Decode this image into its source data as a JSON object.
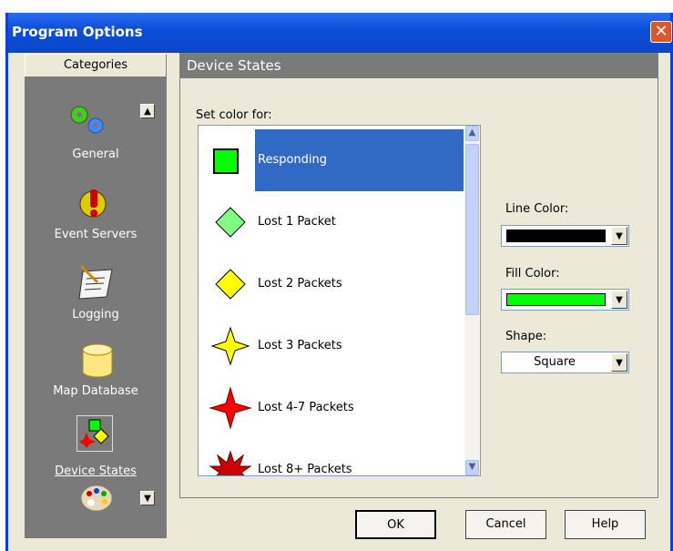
{
  "window": {
    "title": "Program Options",
    "close_glyph": "✕"
  },
  "categories": {
    "header": "Categories",
    "items": [
      {
        "label": "General",
        "icon": "gears-icon"
      },
      {
        "label": "Event Servers",
        "icon": "alert-icon"
      },
      {
        "label": "Logging",
        "icon": "log-icon"
      },
      {
        "label": "Map Database",
        "icon": "database-icon"
      },
      {
        "label": "Device States",
        "icon": "device-states-icon",
        "selected": true
      },
      {
        "label": "",
        "icon": "palette-icon"
      }
    ]
  },
  "panel": {
    "title": "Device States",
    "set_color_label": "Set color for:",
    "states": [
      {
        "label": "Responding",
        "shape": "square",
        "fill": "#00ff00",
        "selected": true
      },
      {
        "label": "Lost 1 Packet",
        "shape": "diamond",
        "fill": "#80ff80"
      },
      {
        "label": "Lost 2 Packets",
        "shape": "diamond",
        "fill": "#ffff00"
      },
      {
        "label": "Lost 3 Packets",
        "shape": "star4",
        "fill": "#ffff00"
      },
      {
        "label": "Lost 4-7 Packets",
        "shape": "star4",
        "fill": "#ff0000"
      },
      {
        "label": "Lost 8+ Packets",
        "shape": "burst",
        "fill": "#cc0000"
      }
    ],
    "line_color_label": "Line Color:",
    "line_color": "#000000",
    "fill_color_label": "Fill Color:",
    "fill_color": "#00ff00",
    "shape_label": "Shape:",
    "shape_value": "Square"
  },
  "buttons": {
    "ok": "OK",
    "cancel": "Cancel",
    "help": "Help"
  }
}
